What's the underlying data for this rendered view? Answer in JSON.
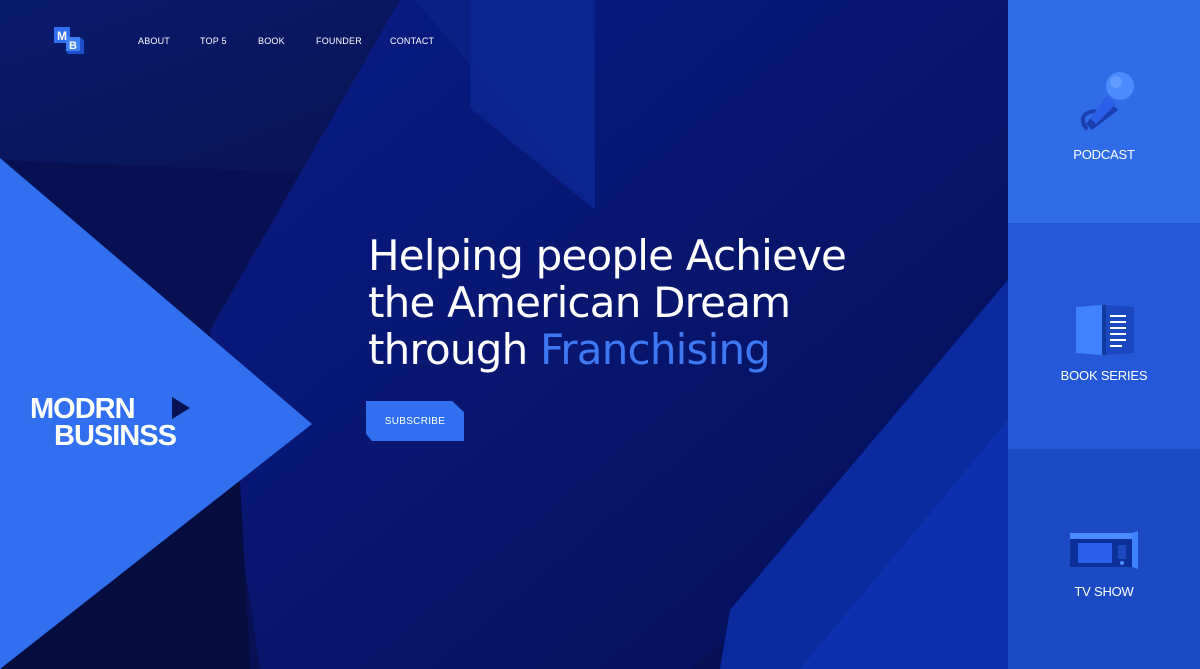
{
  "nav": {
    "items": [
      "ABOUT",
      "TOP 5",
      "BOOK",
      "FOUNDER",
      "CONTACT"
    ]
  },
  "logo": {
    "letters": "MB"
  },
  "brand": {
    "line1": "MODRN",
    "line2": "BUSINSS"
  },
  "hero": {
    "line1": "Helping people Achieve",
    "line2": "the American Dream",
    "line3_prefix": "through",
    "line3_accent": "Franchising",
    "cta": "SUBSCRIBE"
  },
  "sidebar": {
    "items": [
      {
        "label": "PODCAST",
        "icon": "microphone-icon"
      },
      {
        "label": "BOOK SERIES",
        "icon": "book-icon"
      },
      {
        "label": "TV SHOW",
        "icon": "tv-icon"
      }
    ]
  },
  "colors": {
    "background": "#061052",
    "accent": "#3f78f3",
    "button": "#2f6ff0",
    "panel_podcast": "#2f6ce8",
    "panel_book": "#2458d8",
    "panel_tv": "#1c4ac4"
  }
}
